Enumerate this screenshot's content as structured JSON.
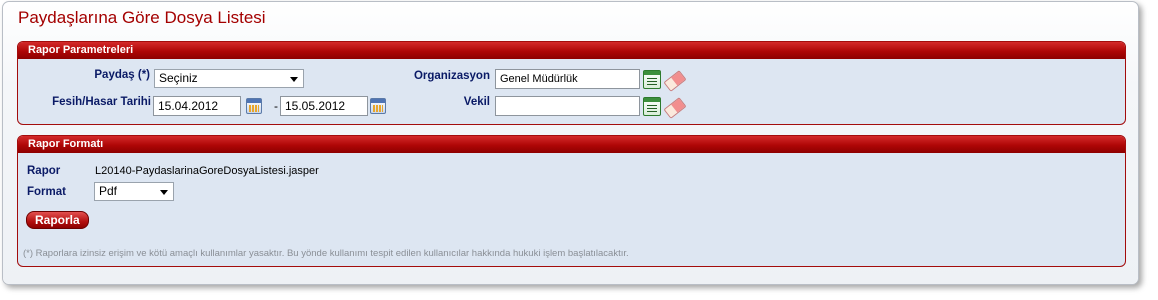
{
  "page": {
    "title": "Paydaşlarına Göre Dosya Listesi"
  },
  "params": {
    "header": "Rapor Parametreleri",
    "paydas_label": "Paydaş (*)",
    "paydas_value": "Seçiniz",
    "fesih_label": "Fesih/Hasar Tarihi",
    "date_from": "15.04.2012",
    "date_sep": "-",
    "date_to": "15.05.2012",
    "org_label": "Organizasyon",
    "org_value": "Genel Müdürlük",
    "vekil_label": "Vekil",
    "vekil_value": ""
  },
  "format": {
    "header": "Rapor Formatı",
    "rapor_label": "Rapor",
    "rapor_value": "L20140-PaydaslarinaGoreDosyaListesi.jasper",
    "format_label": "Format",
    "format_value": "Pdf",
    "button_label": "Raporla",
    "note": "(*) Raporlara izinsiz erişim ve kötü amaçlı kullanımlar yasaktır. Bu yönde kullanımı tespit edilen kullanıcılar hakkında hukuki işlem başlatılacaktır."
  },
  "icons": {
    "calendar": "calendar-icon",
    "list": "list-picker-icon",
    "eraser": "eraser-icon"
  },
  "colors": {
    "accent": "#a40000",
    "label": "#0a1a66",
    "panel_bg": "#dde6f2"
  }
}
